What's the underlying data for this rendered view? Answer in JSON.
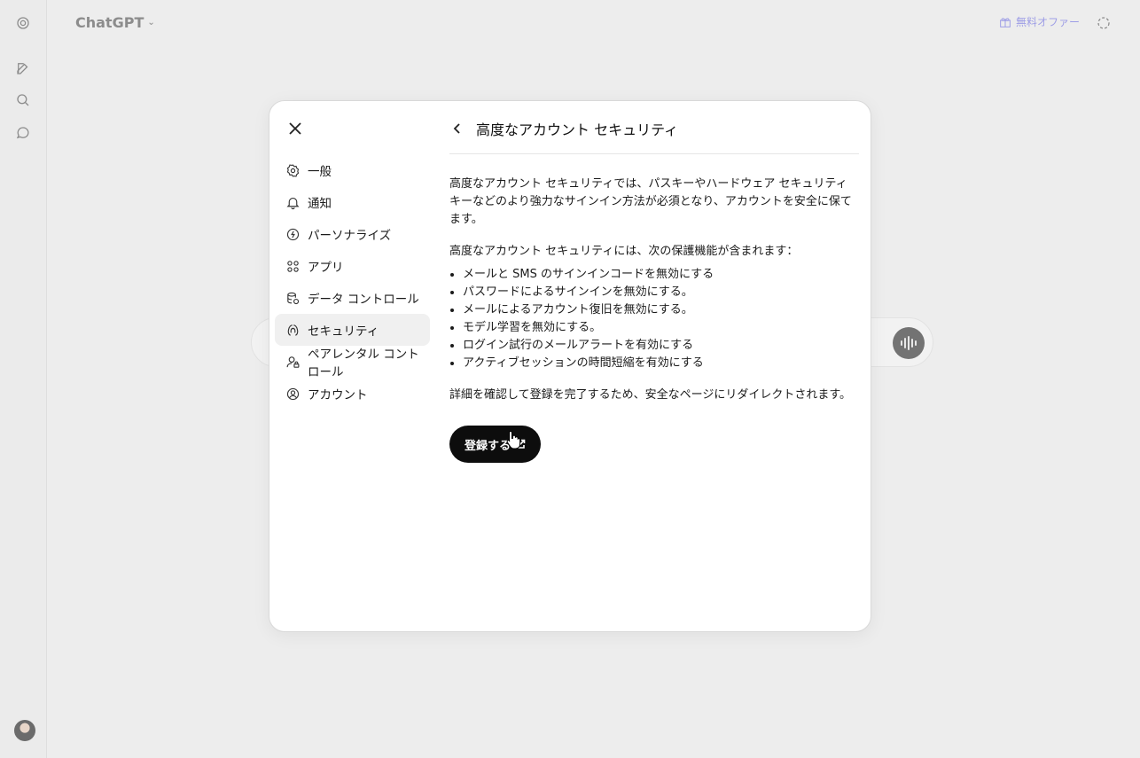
{
  "app": {
    "title": "ChatGPT",
    "offer_label": "無料オファー"
  },
  "rail": {
    "items": [
      "logo-icon",
      "new-chat-icon",
      "search-icon",
      "chat-bubble-icon"
    ]
  },
  "modal": {
    "nav": [
      {
        "label": "一般",
        "icon": "gear-icon"
      },
      {
        "label": "通知",
        "icon": "bell-icon"
      },
      {
        "label": "パーソナライズ",
        "icon": "personalize-icon"
      },
      {
        "label": "アプリ",
        "icon": "apps-icon"
      },
      {
        "label": "データ コントロール",
        "icon": "database-icon"
      },
      {
        "label": "セキュリティ",
        "icon": "security-icon",
        "active": true
      },
      {
        "label": "ペアレンタル コントロール",
        "icon": "parental-icon"
      },
      {
        "label": "アカウント",
        "icon": "account-icon"
      }
    ],
    "title": "高度なアカウント セキュリティ",
    "intro": "高度なアカウント セキュリティでは、パスキーやハードウェア セキュリティ キーなどのより強力なサインイン方法が必須となり、アカウントを安全に保てます。",
    "features_heading": "高度なアカウント セキュリティには、次の保護機能が含まれます：",
    "features": [
      "メールと SMS のサインインコードを無効にする",
      "パスワードによるサインインを無効にする。",
      "メールによるアカウント復旧を無効にする。",
      "モデル学習を無効にする。",
      "ログイン試行のメールアラートを有効にする",
      "アクティブセッションの時間短縮を有効にする"
    ],
    "redirect_note": "詳細を確認して登録を完了するため、安全なページにリダイレクトされます。",
    "register_label": "登録する"
  },
  "colors": {
    "accent": "#0d0d0d",
    "offer": "#9e9ee6",
    "backdrop": "#ededed"
  }
}
